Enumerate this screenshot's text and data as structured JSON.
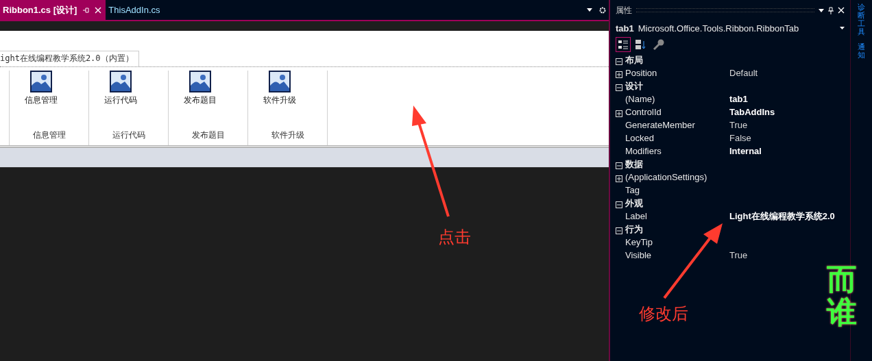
{
  "editor_tabs": [
    {
      "label": "Ribbon1.cs [设计]",
      "selected": true
    },
    {
      "label": "ThisAddIn.cs",
      "selected": false
    }
  ],
  "ribbon": {
    "tab_label": "ight在线编程教学系统2.0（内置）",
    "groups": [
      {
        "button": "信息管理",
        "label": "信息管理"
      },
      {
        "button": "运行代码",
        "label": "运行代码"
      },
      {
        "button": "发布题目",
        "label": "发布题目"
      },
      {
        "button": "软件升级",
        "label": "软件升级"
      }
    ]
  },
  "properties": {
    "title": "属性",
    "object_name": "tab1",
    "object_type": "Microsoft.Office.Tools.Ribbon.RibbonTab",
    "toolbar": [
      {
        "kind": "categorized",
        "selected": true
      },
      {
        "kind": "alphabetical",
        "selected": false
      },
      {
        "kind": "property-pages",
        "selected": false
      }
    ],
    "sections": [
      {
        "name": "布局",
        "expanded": true,
        "rows": [
          {
            "name": "Position",
            "value": "Default",
            "expandable": true,
            "bold": false
          }
        ]
      },
      {
        "name": "设计",
        "expanded": true,
        "rows": [
          {
            "name": "(Name)",
            "value": "tab1",
            "expandable": false,
            "bold": true
          },
          {
            "name": "ControlId",
            "value": "TabAddIns",
            "expandable": true,
            "bold": true
          },
          {
            "name": "GenerateMember",
            "value": "True",
            "expandable": false,
            "bold": false
          },
          {
            "name": "Locked",
            "value": "False",
            "expandable": false,
            "bold": false
          },
          {
            "name": "Modifiers",
            "value": "Internal",
            "expandable": false,
            "bold": true
          }
        ]
      },
      {
        "name": "数据",
        "expanded": true,
        "rows": [
          {
            "name": "(ApplicationSettings)",
            "expandable": true
          },
          {
            "name": "Tag",
            "expandable": false
          }
        ]
      },
      {
        "name": "外观",
        "expanded": true,
        "rows": [
          {
            "name": "Label",
            "value": "Light在线编程教学系统2.0",
            "expandable": false,
            "bold": true
          }
        ]
      },
      {
        "name": "行为",
        "expanded": true,
        "rows": [
          {
            "name": "KeyTip",
            "expandable": false
          },
          {
            "name": "Visible",
            "value": "True",
            "expandable": false,
            "bold": false
          }
        ]
      }
    ]
  },
  "side_tabs": [
    "诊断工具",
    "通知"
  ],
  "annotations": [
    {
      "text": "点击"
    },
    {
      "text": "修改后"
    }
  ],
  "overlay_text": "而谁"
}
